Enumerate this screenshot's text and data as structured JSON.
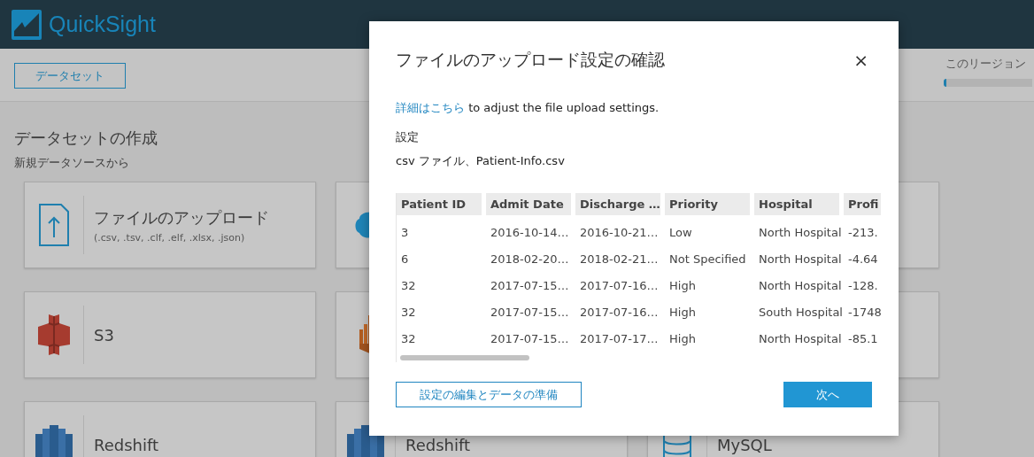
{
  "app": {
    "name": "QuickSight"
  },
  "toolbar": {
    "datasets_button": "データセット",
    "region_label": "このリージョン",
    "region_usage": {
      "level": 0.01
    }
  },
  "create": {
    "title": "データセットの作成",
    "subtitle": "新規データソースから"
  },
  "sources": [
    {
      "kind": "upload",
      "name": "ファイルのアップロード",
      "note": "(.csv, .tsv, .clf, .elf, .xlsx, .json)"
    },
    {
      "kind": "salesforce"
    },
    {
      "kind": "blank"
    },
    {
      "kind": "s3",
      "name": "S3"
    },
    {
      "kind": "athena"
    },
    {
      "kind": "blank"
    },
    {
      "kind": "redshift",
      "name": "Redshift"
    },
    {
      "kind": "redshift",
      "name": "Redshift"
    },
    {
      "kind": "mysql",
      "name": "MySQL"
    }
  ],
  "dialog": {
    "title": "ファイルのアップロード設定の確認",
    "close": "×",
    "link": "詳細はこちら",
    "intro": "to adjust the file upload settings.",
    "settings_label": "設定",
    "file_info": "csv ファイル、Patient-Info.csv",
    "table": {
      "columns": [
        "Patient ID",
        "Admit Date",
        "Discharge …",
        "Priority",
        "Hospital",
        "Profi"
      ],
      "rows": [
        [
          "3",
          "2016-10-14…",
          "2016-10-21…",
          "Low",
          "North Hospital",
          "-213."
        ],
        [
          "6",
          "2018-02-20…",
          "2018-02-21…",
          "Not Specified",
          "North Hospital",
          "-4.64"
        ],
        [
          "32",
          "2017-07-15…",
          "2017-07-16…",
          "High",
          "North Hospital",
          "-128."
        ],
        [
          "32",
          "2017-07-15…",
          "2017-07-16…",
          "High",
          "South Hospital",
          "-1748"
        ],
        [
          "32",
          "2017-07-15…",
          "2017-07-17…",
          "High",
          "North Hospital",
          "-85.1"
        ]
      ]
    },
    "buttons": {
      "edit": "設定の編集とデータの準備",
      "next": "次へ"
    }
  }
}
